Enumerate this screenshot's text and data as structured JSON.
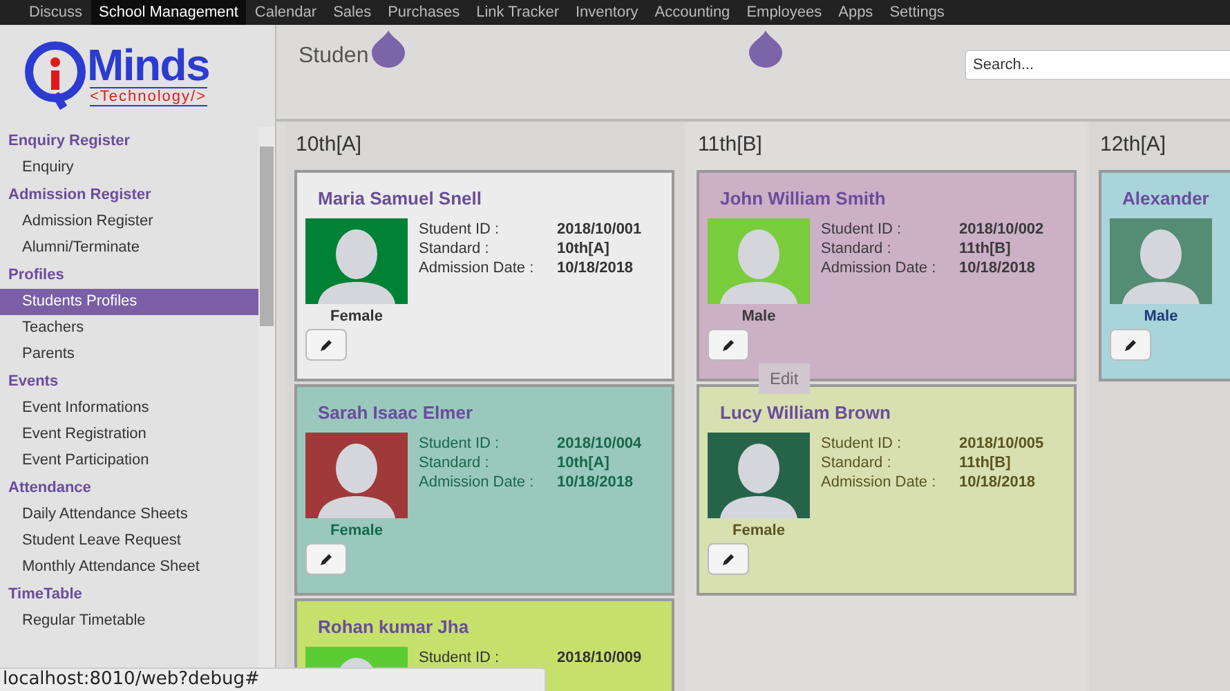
{
  "top_menu": [
    {
      "label": "Discuss",
      "selected": false
    },
    {
      "label": "School Management",
      "selected": true
    },
    {
      "label": "Calendar",
      "selected": false
    },
    {
      "label": "Sales",
      "selected": false
    },
    {
      "label": "Purchases",
      "selected": false
    },
    {
      "label": "Link Tracker",
      "selected": false
    },
    {
      "label": "Inventory",
      "selected": false
    },
    {
      "label": "Accounting",
      "selected": false
    },
    {
      "label": "Employees",
      "selected": false
    },
    {
      "label": "Apps",
      "selected": false
    },
    {
      "label": "Settings",
      "selected": false
    }
  ],
  "logo": {
    "word": "Minds",
    "tagline": "<Technology/>"
  },
  "sidebar": {
    "sections": [
      {
        "title": "Enquiry Register",
        "items": [
          {
            "label": "Enquiry",
            "selected": false
          }
        ]
      },
      {
        "title": "Admission Register",
        "items": [
          {
            "label": "Admission Register",
            "selected": false
          },
          {
            "label": "Alumni/Terminate",
            "selected": false
          }
        ]
      },
      {
        "title": "Profiles",
        "items": [
          {
            "label": "Students Profiles",
            "selected": true
          },
          {
            "label": "Teachers",
            "selected": false
          },
          {
            "label": "Parents",
            "selected": false
          }
        ]
      },
      {
        "title": "Events",
        "items": [
          {
            "label": "Event Informations",
            "selected": false
          },
          {
            "label": "Event Registration",
            "selected": false
          },
          {
            "label": "Event Participation",
            "selected": false
          }
        ]
      },
      {
        "title": "Attendance",
        "items": [
          {
            "label": "Daily Attendance Sheets",
            "selected": false
          },
          {
            "label": "Student Leave Request",
            "selected": false
          },
          {
            "label": "Monthly Attendance Sheet",
            "selected": false
          }
        ]
      },
      {
        "title": "TimeTable",
        "items": [
          {
            "label": "Regular Timetable",
            "selected": false
          }
        ]
      }
    ]
  },
  "header": {
    "title": "Studen",
    "search": {
      "placeholder": "Search..."
    }
  },
  "columns": [
    {
      "title": "10th[A]",
      "cards": [
        {
          "name": "Maria Samuel Snell",
          "color": "#ececec",
          "photo": {
            "color": "#008236"
          },
          "gender": {
            "label": "Female",
            "color": "#333333"
          },
          "fields": [
            {
              "label": "Student ID :",
              "value": "2018/10/001"
            },
            {
              "label": "Standard :",
              "value": "10th[A]"
            },
            {
              "label": "Admission Date :",
              "value": "10/18/2018"
            }
          ]
        },
        {
          "name": "Sarah Isaac Elmer",
          "color": "#9ac8bd",
          "photo": {
            "color": "#a03a3a"
          },
          "gender": {
            "label": "Female",
            "color": "#17694a"
          },
          "fields": [
            {
              "label": "Student ID :",
              "value": "2018/10/004"
            },
            {
              "label": "Standard :",
              "value": "10th[A]"
            },
            {
              "label": "Admission Date :",
              "value": "10/18/2018"
            }
          ]
        },
        {
          "name": "Rohan kumar Jha",
          "color": "#c6e06c",
          "photo": {
            "color": "#5ccc34"
          },
          "fields": [
            {
              "label": "Student ID :",
              "value": "2018/10/009"
            }
          ]
        }
      ]
    },
    {
      "title": "11th[B]",
      "cards": [
        {
          "name": "John William Smith",
          "color": "#cbb0c6",
          "photo": {
            "color": "#7acc3c"
          },
          "gender": {
            "label": "Male",
            "color": "#3a3a3a"
          },
          "tooltip": "Edit",
          "fields": [
            {
              "label": "Student ID :",
              "value": "2018/10/002"
            },
            {
              "label": "Standard :",
              "value": "11th[B]"
            },
            {
              "label": "Admission Date :",
              "value": "10/18/2018"
            }
          ]
        },
        {
          "name": "Lucy William Brown",
          "color": "#d8e0b2",
          "photo": {
            "color": "#26644a"
          },
          "gender": {
            "label": "Female",
            "color": "#5a5420"
          },
          "fields": [
            {
              "label": "Student ID :",
              "value": "2018/10/005"
            },
            {
              "label": "Standard :",
              "value": "11th[B]"
            },
            {
              "label": "Admission Date :",
              "value": "10/18/2018"
            }
          ]
        }
      ]
    },
    {
      "title": "12th[A]",
      "cards": [
        {
          "name": "Alexander",
          "color": "#a8d4da",
          "photo": {
            "color": "#548c74"
          },
          "gender": {
            "label": "Male",
            "color": "#1e3a78"
          }
        }
      ]
    }
  ],
  "status_bar": "localhost:8010/web?debug#"
}
